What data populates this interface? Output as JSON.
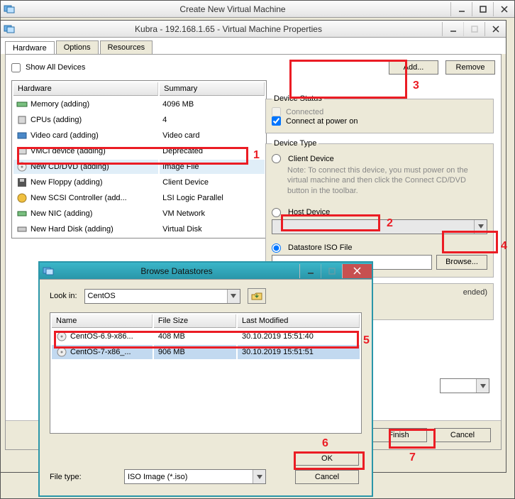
{
  "outerWindow": {
    "title": "Create New Virtual Machine"
  },
  "propsWindow": {
    "title": "Kubra - 192.168.1.65 - Virtual Machine Properties",
    "tabs": [
      "Hardware",
      "Options",
      "Resources"
    ],
    "showAll": "Show All Devices",
    "addBtn": "Add...",
    "removeBtn": "Remove",
    "cols": {
      "hardware": "Hardware",
      "summary": "Summary"
    },
    "rows": [
      {
        "icon": "memory",
        "name": "Memory (adding)",
        "summary": "4096 MB"
      },
      {
        "icon": "cpu",
        "name": "CPUs (adding)",
        "summary": "4"
      },
      {
        "icon": "video",
        "name": "Video card  (adding)",
        "summary": "Video card"
      },
      {
        "icon": "vmci",
        "name": "VMCI device  (adding)",
        "summary": "Deprecated"
      },
      {
        "icon": "cd",
        "name": "New CD/DVD (adding)",
        "summary": "Image File",
        "selected": true
      },
      {
        "icon": "floppy",
        "name": "New Floppy (adding)",
        "summary": "Client Device"
      },
      {
        "icon": "scsi",
        "name": "New SCSI Controller (add...",
        "summary": "LSI Logic Parallel"
      },
      {
        "icon": "nic",
        "name": "New NIC (adding)",
        "summary": "VM Network"
      },
      {
        "icon": "hdd",
        "name": "New Hard Disk (adding)",
        "summary": "Virtual Disk"
      }
    ],
    "deviceStatus": {
      "legend": "Device Status",
      "connected": "Connected",
      "connectPower": "Connect at power on"
    },
    "deviceType": {
      "legend": "Device Type",
      "client": "Client Device",
      "clientNote": "Note: To connect this device, you must power on the virtual machine and then click the Connect CD/DVD button in the toolbar.",
      "host": "Host Device",
      "datastore": "Datastore ISO File",
      "browse": "Browse..."
    },
    "suffixEnded": "ended)",
    "finish": "Finish",
    "cancel": "Cancel"
  },
  "browseDialog": {
    "title": "Browse Datastores",
    "lookIn": "Look in:",
    "lookInValue": "CentOS",
    "cols": {
      "name": "Name",
      "size": "File Size",
      "modified": "Last Modified"
    },
    "rows": [
      {
        "name": "CentOS-6.9-x86...",
        "size": "408 MB",
        "modified": "30.10.2019 15:51:40"
      },
      {
        "name": "CentOS-7-x86_...",
        "size": "906 MB",
        "modified": "30.10.2019 15:51:51",
        "selected": true
      }
    ],
    "fileType": "File type:",
    "fileTypeValue": "ISO Image (*.iso)",
    "ok": "OK",
    "cancel": "Cancel"
  },
  "annotations": {
    "1": "1",
    "2": "2",
    "3": "3",
    "4": "4",
    "5": "5",
    "6": "6",
    "7": "7"
  }
}
